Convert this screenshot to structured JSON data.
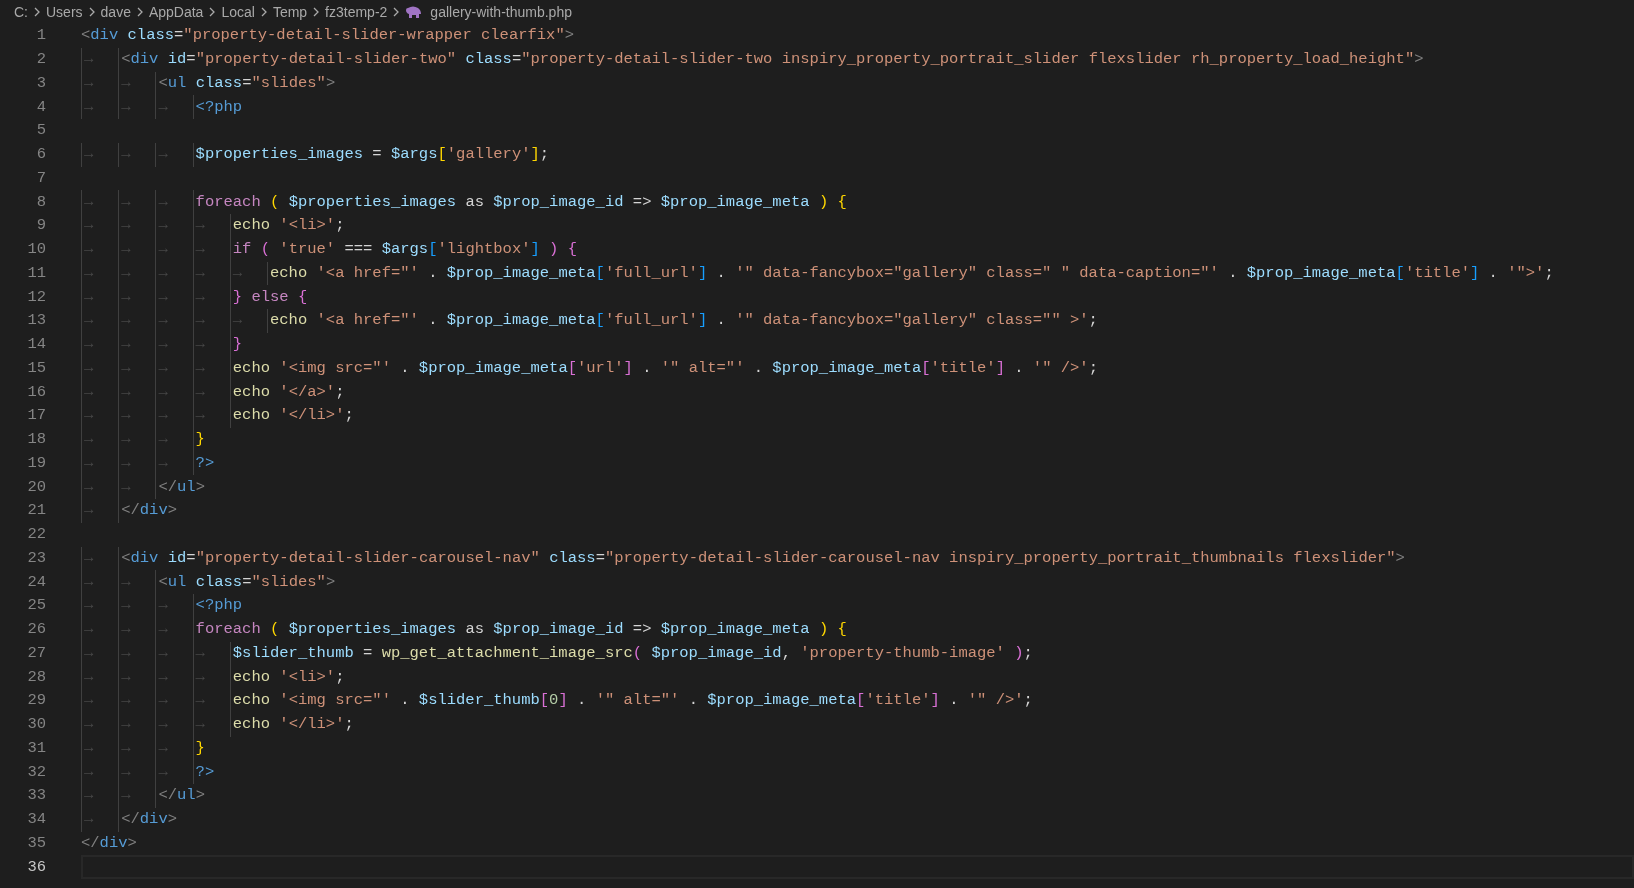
{
  "breadcrumb": [
    {
      "kind": "folder",
      "label": "C:"
    },
    {
      "kind": "folder",
      "label": "Users"
    },
    {
      "kind": "folder",
      "label": "dave"
    },
    {
      "kind": "folder",
      "label": "AppData"
    },
    {
      "kind": "folder",
      "label": "Local"
    },
    {
      "kind": "folder",
      "label": "Temp"
    },
    {
      "kind": "folder",
      "label": "fz3temp-2"
    },
    {
      "kind": "file",
      "label": "gallery-with-thumb.php"
    }
  ],
  "lines": [
    {
      "number": "1",
      "current": false,
      "tokens": [
        {
          "kind": "angle",
          "text": "<"
        },
        {
          "kind": "tag",
          "text": "div "
        },
        {
          "kind": "attr",
          "text": "class"
        },
        {
          "kind": "plain",
          "text": "="
        },
        {
          "kind": "string",
          "text": "\"property-detail-slider-wrapper clearfix\""
        },
        {
          "kind": "angle",
          "text": ">"
        }
      ]
    },
    {
      "number": "2",
      "current": false,
      "indent": "→",
      "tokens": [
        {
          "kind": "angle",
          "text": "<"
        },
        {
          "kind": "tag",
          "text": "div "
        },
        {
          "kind": "attr",
          "text": "id"
        },
        {
          "kind": "plain",
          "text": "="
        },
        {
          "kind": "string",
          "text": "\"property-detail-slider-two\" "
        },
        {
          "kind": "attr",
          "text": "class"
        },
        {
          "kind": "plain",
          "text": "="
        },
        {
          "kind": "string",
          "text": "\"property-detail-slider-two inspiry_property_portrait_slider flexslider rh_property_load_height\""
        },
        {
          "kind": "angle",
          "text": ">"
        }
      ]
    },
    {
      "number": "3",
      "current": false,
      "indent": "→→",
      "tokens": [
        {
          "kind": "angle",
          "text": "<"
        },
        {
          "kind": "tag",
          "text": "ul "
        },
        {
          "kind": "attr",
          "text": "class"
        },
        {
          "kind": "plain",
          "text": "="
        },
        {
          "kind": "string",
          "text": "\"slides\""
        },
        {
          "kind": "angle",
          "text": ">"
        }
      ]
    },
    {
      "number": "4",
      "current": false,
      "indent": "→→→",
      "tokens": [
        {
          "kind": "php",
          "text": "<?php"
        }
      ]
    },
    {
      "number": "5",
      "current": false
    },
    {
      "number": "6",
      "current": false,
      "indent": "→→→",
      "tokens": [
        {
          "kind": "var",
          "text": "$properties_images"
        },
        {
          "kind": "plain",
          "text": " = "
        },
        {
          "kind": "var",
          "text": "$args"
        },
        {
          "kind": "bracket1",
          "text": "["
        },
        {
          "kind": "string",
          "text": "'gallery'"
        },
        {
          "kind": "bracket1",
          "text": "]"
        },
        {
          "kind": "plain",
          "text": ";"
        }
      ]
    },
    {
      "number": "7",
      "current": false
    },
    {
      "number": "8",
      "current": false,
      "indent": "→→→",
      "tokens": [
        {
          "kind": "keyword",
          "text": "foreach "
        },
        {
          "kind": "bracket1",
          "text": "( "
        },
        {
          "kind": "var",
          "text": "$properties_images"
        },
        {
          "kind": "plain",
          "text": " as "
        },
        {
          "kind": "var",
          "text": "$prop_image_id"
        },
        {
          "kind": "plain",
          "text": " => "
        },
        {
          "kind": "var",
          "text": "$prop_image_meta "
        },
        {
          "kind": "bracket1",
          "text": ") "
        },
        {
          "kind": "bracket1",
          "text": "{"
        }
      ]
    },
    {
      "number": "9",
      "current": false,
      "indent": "→→→→",
      "tokens": [
        {
          "kind": "func",
          "text": "echo "
        },
        {
          "kind": "string",
          "text": "'<li>'"
        },
        {
          "kind": "plain",
          "text": ";"
        }
      ]
    },
    {
      "number": "10",
      "current": false,
      "indent": "→→→→",
      "tokens": [
        {
          "kind": "keyword",
          "text": "if "
        },
        {
          "kind": "bracket2",
          "text": "( "
        },
        {
          "kind": "string",
          "text": "'true'"
        },
        {
          "kind": "plain",
          "text": " === "
        },
        {
          "kind": "var",
          "text": "$args"
        },
        {
          "kind": "bracket3",
          "text": "["
        },
        {
          "kind": "string",
          "text": "'lightbox'"
        },
        {
          "kind": "bracket3",
          "text": "] "
        },
        {
          "kind": "bracket2",
          "text": ") "
        },
        {
          "kind": "bracket2",
          "text": "{"
        }
      ]
    },
    {
      "number": "11",
      "current": false,
      "indent": "→→→→→",
      "tokens": [
        {
          "kind": "func",
          "text": "echo "
        },
        {
          "kind": "string",
          "text": "'<a href=\"'"
        },
        {
          "kind": "plain",
          "text": " . "
        },
        {
          "kind": "var",
          "text": "$prop_image_meta"
        },
        {
          "kind": "bracket3",
          "text": "["
        },
        {
          "kind": "string",
          "text": "'full_url'"
        },
        {
          "kind": "bracket3",
          "text": "]"
        },
        {
          "kind": "plain",
          "text": " . "
        },
        {
          "kind": "string",
          "text": "'\" data-fancybox=\"gallery\" class=\" \" data-caption=\"'"
        },
        {
          "kind": "plain",
          "text": " . "
        },
        {
          "kind": "var",
          "text": "$prop_image_meta"
        },
        {
          "kind": "bracket3",
          "text": "["
        },
        {
          "kind": "string",
          "text": "'title'"
        },
        {
          "kind": "bracket3",
          "text": "]"
        },
        {
          "kind": "plain",
          "text": " . "
        },
        {
          "kind": "string",
          "text": "'\">'"
        },
        {
          "kind": "plain",
          "text": ";"
        }
      ]
    },
    {
      "number": "12",
      "current": false,
      "indent": "→→→→",
      "tokens": [
        {
          "kind": "bracket2",
          "text": "} "
        },
        {
          "kind": "keyword",
          "text": "else "
        },
        {
          "kind": "bracket2",
          "text": "{"
        }
      ]
    },
    {
      "number": "13",
      "current": false,
      "indent": "→→→→→",
      "tokens": [
        {
          "kind": "func",
          "text": "echo "
        },
        {
          "kind": "string",
          "text": "'<a href=\"'"
        },
        {
          "kind": "plain",
          "text": " . "
        },
        {
          "kind": "var",
          "text": "$prop_image_meta"
        },
        {
          "kind": "bracket3",
          "text": "["
        },
        {
          "kind": "string",
          "text": "'full_url'"
        },
        {
          "kind": "bracket3",
          "text": "]"
        },
        {
          "kind": "plain",
          "text": " . "
        },
        {
          "kind": "string",
          "text": "'\" data-fancybox=\"gallery\" class=\"\" >'"
        },
        {
          "kind": "plain",
          "text": ";"
        }
      ]
    },
    {
      "number": "14",
      "current": false,
      "indent": "→→→→",
      "tokens": [
        {
          "kind": "bracket2",
          "text": "}"
        }
      ]
    },
    {
      "number": "15",
      "current": false,
      "indent": "→→→→",
      "tokens": [
        {
          "kind": "func",
          "text": "echo "
        },
        {
          "kind": "string",
          "text": "'<img src=\"'"
        },
        {
          "kind": "plain",
          "text": " . "
        },
        {
          "kind": "var",
          "text": "$prop_image_meta"
        },
        {
          "kind": "bracket2",
          "text": "["
        },
        {
          "kind": "string",
          "text": "'url'"
        },
        {
          "kind": "bracket2",
          "text": "]"
        },
        {
          "kind": "plain",
          "text": " . "
        },
        {
          "kind": "string",
          "text": "'\" alt=\"'"
        },
        {
          "kind": "plain",
          "text": " . "
        },
        {
          "kind": "var",
          "text": "$prop_image_meta"
        },
        {
          "kind": "bracket2",
          "text": "["
        },
        {
          "kind": "string",
          "text": "'title'"
        },
        {
          "kind": "bracket2",
          "text": "]"
        },
        {
          "kind": "plain",
          "text": " . "
        },
        {
          "kind": "string",
          "text": "'\" />'"
        },
        {
          "kind": "plain",
          "text": ";"
        }
      ]
    },
    {
      "number": "16",
      "current": false,
      "indent": "→→→→",
      "tokens": [
        {
          "kind": "func",
          "text": "echo "
        },
        {
          "kind": "string",
          "text": "'</a>'"
        },
        {
          "kind": "plain",
          "text": ";"
        }
      ]
    },
    {
      "number": "17",
      "current": false,
      "indent": "→→→→",
      "tokens": [
        {
          "kind": "func",
          "text": "echo "
        },
        {
          "kind": "string",
          "text": "'</li>'"
        },
        {
          "kind": "plain",
          "text": ";"
        }
      ]
    },
    {
      "number": "18",
      "current": false,
      "indent": "→→→",
      "tokens": [
        {
          "kind": "bracket1",
          "text": "}"
        }
      ]
    },
    {
      "number": "19",
      "current": false,
      "indent": "→→→",
      "tokens": [
        {
          "kind": "php",
          "text": "?>"
        }
      ]
    },
    {
      "number": "20",
      "current": false,
      "indent": "→→",
      "tokens": [
        {
          "kind": "angle",
          "text": "</"
        },
        {
          "kind": "tag",
          "text": "ul"
        },
        {
          "kind": "angle",
          "text": ">"
        }
      ]
    },
    {
      "number": "21",
      "current": false,
      "indent": "→",
      "tokens": [
        {
          "kind": "angle",
          "text": "</"
        },
        {
          "kind": "tag",
          "text": "div"
        },
        {
          "kind": "angle",
          "text": ">"
        }
      ]
    },
    {
      "number": "22",
      "current": false
    },
    {
      "number": "23",
      "current": false,
      "indent": "→",
      "tokens": [
        {
          "kind": "angle",
          "text": "<"
        },
        {
          "kind": "tag",
          "text": "div "
        },
        {
          "kind": "attr",
          "text": "id"
        },
        {
          "kind": "plain",
          "text": "="
        },
        {
          "kind": "string",
          "text": "\"property-detail-slider-carousel-nav\" "
        },
        {
          "kind": "attr",
          "text": "class"
        },
        {
          "kind": "plain",
          "text": "="
        },
        {
          "kind": "string",
          "text": "\"property-detail-slider-carousel-nav inspiry_property_portrait_thumbnails flexslider\""
        },
        {
          "kind": "angle",
          "text": ">"
        }
      ]
    },
    {
      "number": "24",
      "current": false,
      "indent": "→→",
      "tokens": [
        {
          "kind": "angle",
          "text": "<"
        },
        {
          "kind": "tag",
          "text": "ul "
        },
        {
          "kind": "attr",
          "text": "class"
        },
        {
          "kind": "plain",
          "text": "="
        },
        {
          "kind": "string",
          "text": "\"slides\""
        },
        {
          "kind": "angle",
          "text": ">"
        }
      ]
    },
    {
      "number": "25",
      "current": false,
      "indent": "→→→",
      "tokens": [
        {
          "kind": "php",
          "text": "<?php"
        }
      ]
    },
    {
      "number": "26",
      "current": false,
      "indent": "→→→",
      "tokens": [
        {
          "kind": "keyword",
          "text": "foreach "
        },
        {
          "kind": "bracket1",
          "text": "( "
        },
        {
          "kind": "var",
          "text": "$properties_images"
        },
        {
          "kind": "plain",
          "text": " as "
        },
        {
          "kind": "var",
          "text": "$prop_image_id"
        },
        {
          "kind": "plain",
          "text": " => "
        },
        {
          "kind": "var",
          "text": "$prop_image_meta "
        },
        {
          "kind": "bracket1",
          "text": ") "
        },
        {
          "kind": "bracket1",
          "text": "{"
        }
      ]
    },
    {
      "number": "27",
      "current": false,
      "indent": "→→→→",
      "tokens": [
        {
          "kind": "var",
          "text": "$slider_thumb"
        },
        {
          "kind": "plain",
          "text": " = "
        },
        {
          "kind": "func",
          "text": "wp_get_attachment_image_src"
        },
        {
          "kind": "bracket2",
          "text": "( "
        },
        {
          "kind": "var",
          "text": "$prop_image_id"
        },
        {
          "kind": "plain",
          "text": ", "
        },
        {
          "kind": "string",
          "text": "'property-thumb-image' "
        },
        {
          "kind": "bracket2",
          "text": ")"
        },
        {
          "kind": "plain",
          "text": ";"
        }
      ]
    },
    {
      "number": "28",
      "current": false,
      "indent": "→→→→",
      "tokens": [
        {
          "kind": "func",
          "text": "echo "
        },
        {
          "kind": "string",
          "text": "'<li>'"
        },
        {
          "kind": "plain",
          "text": ";"
        }
      ]
    },
    {
      "number": "29",
      "current": false,
      "indent": "→→→→",
      "tokens": [
        {
          "kind": "func",
          "text": "echo "
        },
        {
          "kind": "string",
          "text": "'<img src=\"'"
        },
        {
          "kind": "plain",
          "text": " . "
        },
        {
          "kind": "var",
          "text": "$slider_thumb"
        },
        {
          "kind": "bracket2",
          "text": "["
        },
        {
          "kind": "num",
          "text": "0"
        },
        {
          "kind": "bracket2",
          "text": "]"
        },
        {
          "kind": "plain",
          "text": " . "
        },
        {
          "kind": "string",
          "text": "'\" alt=\"'"
        },
        {
          "kind": "plain",
          "text": " . "
        },
        {
          "kind": "var",
          "text": "$prop_image_meta"
        },
        {
          "kind": "bracket2",
          "text": "["
        },
        {
          "kind": "string",
          "text": "'title'"
        },
        {
          "kind": "bracket2",
          "text": "]"
        },
        {
          "kind": "plain",
          "text": " . "
        },
        {
          "kind": "string",
          "text": "'\" />'"
        },
        {
          "kind": "plain",
          "text": ";"
        }
      ]
    },
    {
      "number": "30",
      "current": false,
      "indent": "→→→→",
      "tokens": [
        {
          "kind": "func",
          "text": "echo "
        },
        {
          "kind": "string",
          "text": "'</li>'"
        },
        {
          "kind": "plain",
          "text": ";"
        }
      ]
    },
    {
      "number": "31",
      "current": false,
      "indent": "→→→",
      "tokens": [
        {
          "kind": "bracket1",
          "text": "}"
        }
      ]
    },
    {
      "number": "32",
      "current": false,
      "indent": "→→→",
      "tokens": [
        {
          "kind": "php",
          "text": "?>"
        }
      ]
    },
    {
      "number": "33",
      "current": false,
      "indent": "→→",
      "tokens": [
        {
          "kind": "angle",
          "text": "</"
        },
        {
          "kind": "tag",
          "text": "ul"
        },
        {
          "kind": "angle",
          "text": ">"
        }
      ]
    },
    {
      "number": "34",
      "current": false,
      "indent": "→",
      "tokens": [
        {
          "kind": "angle",
          "text": "</"
        },
        {
          "kind": "tag",
          "text": "div"
        },
        {
          "kind": "angle",
          "text": ">"
        }
      ]
    },
    {
      "number": "35",
      "current": false,
      "tokens": [
        {
          "kind": "angle",
          "text": "</"
        },
        {
          "kind": "tag",
          "text": "div"
        },
        {
          "kind": "angle",
          "text": ">"
        }
      ]
    },
    {
      "number": "36",
      "current": true
    }
  ]
}
